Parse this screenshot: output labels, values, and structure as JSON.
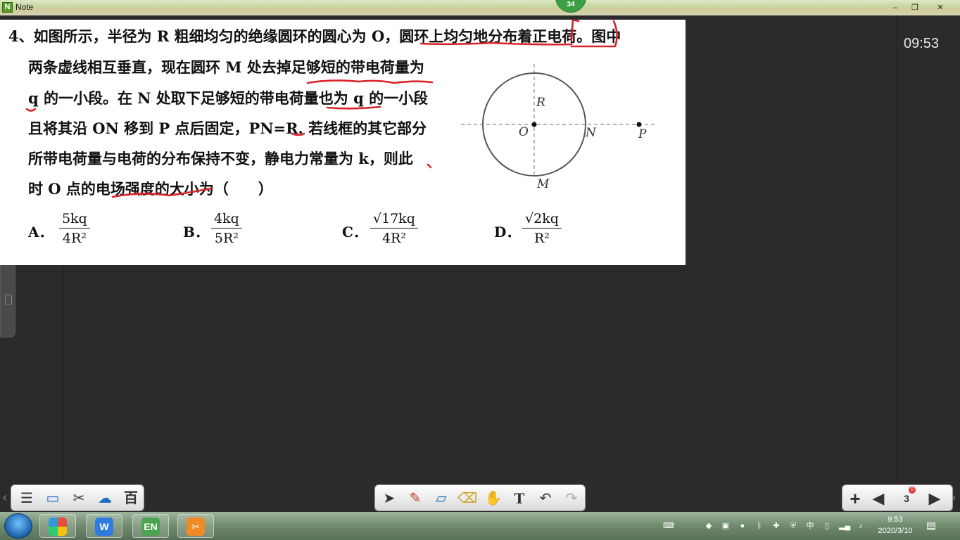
{
  "window": {
    "title": "Note",
    "page_badge": "34",
    "minimize": "–",
    "restore": "❐",
    "close": "✕"
  },
  "clock": "09:53",
  "question": {
    "lines": [
      "4、如图所示，半径为 R 粗细均匀的绝缘圆环的圆心为 O，圆环上均匀地分布着正电荷。图中",
      "两条虚线相互垂直，现在圆环 M 处去掉足够短的带电荷量为",
      "q 的一小段。在 N 处取下足够短的带电荷量也为 q 的一小段",
      "且将其沿 ON 移到 P 点后固定，PN=R. 若线框的其它部分",
      "所带电荷量与电荷的分布保持不变，静电力常量为 k，则此",
      "时 O 点的电场强度的大小为（　　）"
    ],
    "options": [
      {
        "letter": "A．",
        "num": "5kq",
        "den": "4R²"
      },
      {
        "letter": "B．",
        "num": "4kq",
        "den": "5R²"
      },
      {
        "letter": "C．",
        "num": "√17kq",
        "den": "4R²"
      },
      {
        "letter": "D．",
        "num": "√2kq",
        "den": "R²"
      }
    ],
    "diagram_labels": {
      "O": "O",
      "R": "R",
      "N": "N",
      "P": "P",
      "M": "M"
    }
  },
  "toolbar": {
    "left": [
      "menu-icon",
      "display-icon",
      "tools-icon",
      "cloud-icon",
      "baidu-icon"
    ],
    "center": [
      "pointer-icon",
      "pen-icon",
      "ruler-icon",
      "eraser-icon",
      "hand-icon",
      "text-icon",
      "undo-icon",
      "redo-icon"
    ],
    "text_tool": "T",
    "page_number": "3",
    "page_notif": "0"
  },
  "taskbar": {
    "apps": [
      "WPS",
      "EN",
      "Note"
    ],
    "time": "9:53",
    "date": "2020/3/10"
  }
}
